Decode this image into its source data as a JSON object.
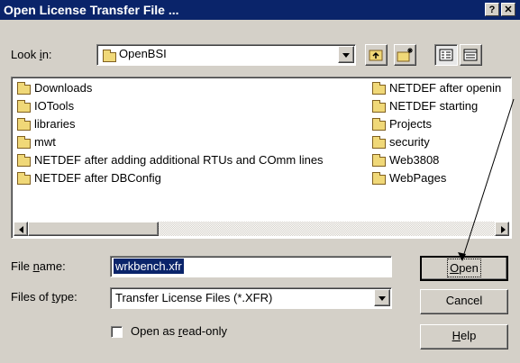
{
  "window": {
    "title": "Open License Transfer File ...",
    "help_glyph": "?",
    "close_glyph": "✕"
  },
  "look_in": {
    "label_pre": "Look ",
    "label_key": "i",
    "label_post": "n:",
    "value": "OpenBSI"
  },
  "toolbar": {
    "up_icon": "up-folder-icon",
    "new_folder_icon": "new-folder-icon",
    "list_icon": "list-view-icon",
    "details_icon": "details-view-icon"
  },
  "files_left": [
    "Downloads",
    "IOTools",
    "libraries",
    "mwt",
    "NETDEF after adding additional RTUs and COmm lines",
    "NETDEF after DBConfig"
  ],
  "files_right": [
    "NETDEF after openin",
    "NETDEF starting",
    "Projects",
    "security",
    "Web3808",
    "WebPages"
  ],
  "file_name": {
    "label_pre": "File ",
    "label_key": "n",
    "label_post": "ame:",
    "value": "wrkbench.xfr"
  },
  "file_type": {
    "label_pre": "Files of ",
    "label_key": "t",
    "label_post": "ype:",
    "value": "Transfer License Files (*.XFR)"
  },
  "readonly": {
    "label_pre": "Open as ",
    "label_key": "r",
    "label_post": "ead-only",
    "checked": false
  },
  "buttons": {
    "open_key": "O",
    "open_rest": "pen",
    "cancel": "Cancel",
    "help_key": "H",
    "help_rest": "elp"
  }
}
